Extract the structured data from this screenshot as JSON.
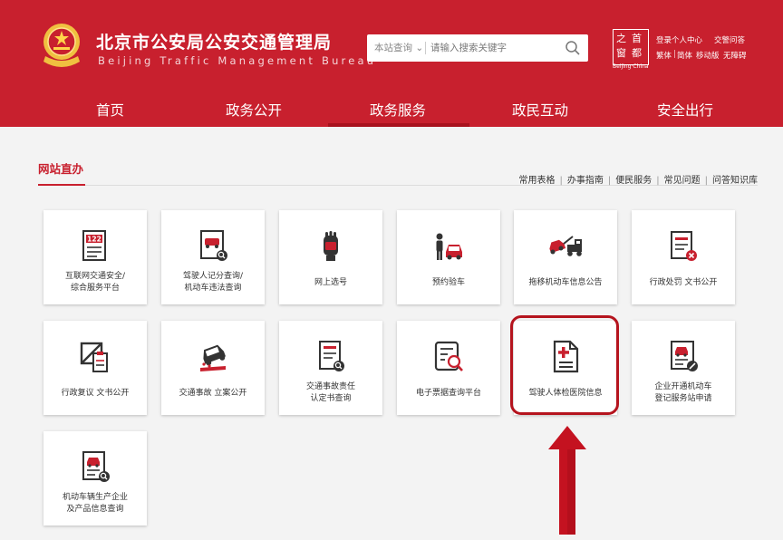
{
  "header": {
    "title_cn": "北京市公安局公安交通管理局",
    "title_en": "Beijing Traffic Management Bureau",
    "search": {
      "scope": "本站查询",
      "placeholder": "请输入搜索关键字"
    },
    "capital_logo": {
      "chars": [
        "首",
        "都",
        "之",
        "窗"
      ],
      "subtitle": "Beijing·China"
    },
    "top_links": [
      "登录个人中心",
      "交警问答",
      "繁体",
      "简体",
      "移动版",
      "无障碍"
    ]
  },
  "nav": {
    "items": [
      "首页",
      "政务公开",
      "政务服务",
      "政民互动",
      "安全出行"
    ],
    "active_index": 2
  },
  "section": {
    "title": "网站直办",
    "quick_links": [
      "常用表格",
      "办事指南",
      "便民服务",
      "常见问题",
      "问答知识库"
    ]
  },
  "tiles": [
    {
      "label": "互联网交通安全/\n综合服务平台",
      "icon": "122-platform-icon"
    },
    {
      "label": "驾驶人记分查询/\n机动车违法查询",
      "icon": "violation-query-icon"
    },
    {
      "label": "网上选号",
      "icon": "plate-select-icon"
    },
    {
      "label": "预约验车",
      "icon": "inspection-appointment-icon"
    },
    {
      "label": "拖移机动车信息公告",
      "icon": "tow-truck-icon"
    },
    {
      "label": "行政处罚 文书公开",
      "icon": "penalty-document-icon"
    },
    {
      "label": "行政复议 文书公开",
      "icon": "review-document-icon"
    },
    {
      "label": "交通事故 立案公开",
      "icon": "accident-filing-icon"
    },
    {
      "label": "交通事故责任\n认定书查询",
      "icon": "accident-liability-query-icon"
    },
    {
      "label": "电子票据查询平台",
      "icon": "e-invoice-query-icon"
    },
    {
      "label": "驾驶人体检医院信息",
      "icon": "medical-document-icon"
    },
    {
      "label": "企业开通机动车\n登记服务站申请",
      "icon": "registration-station-icon"
    },
    {
      "label": "机动车辆生产企业\n及产品信息查询",
      "icon": "manufacturer-query-icon"
    }
  ],
  "colors": {
    "brand_red": "#c8202e",
    "nav_active": "#a8121e",
    "highlight": "#b5141e",
    "page_bg": "#f3f3f3"
  }
}
